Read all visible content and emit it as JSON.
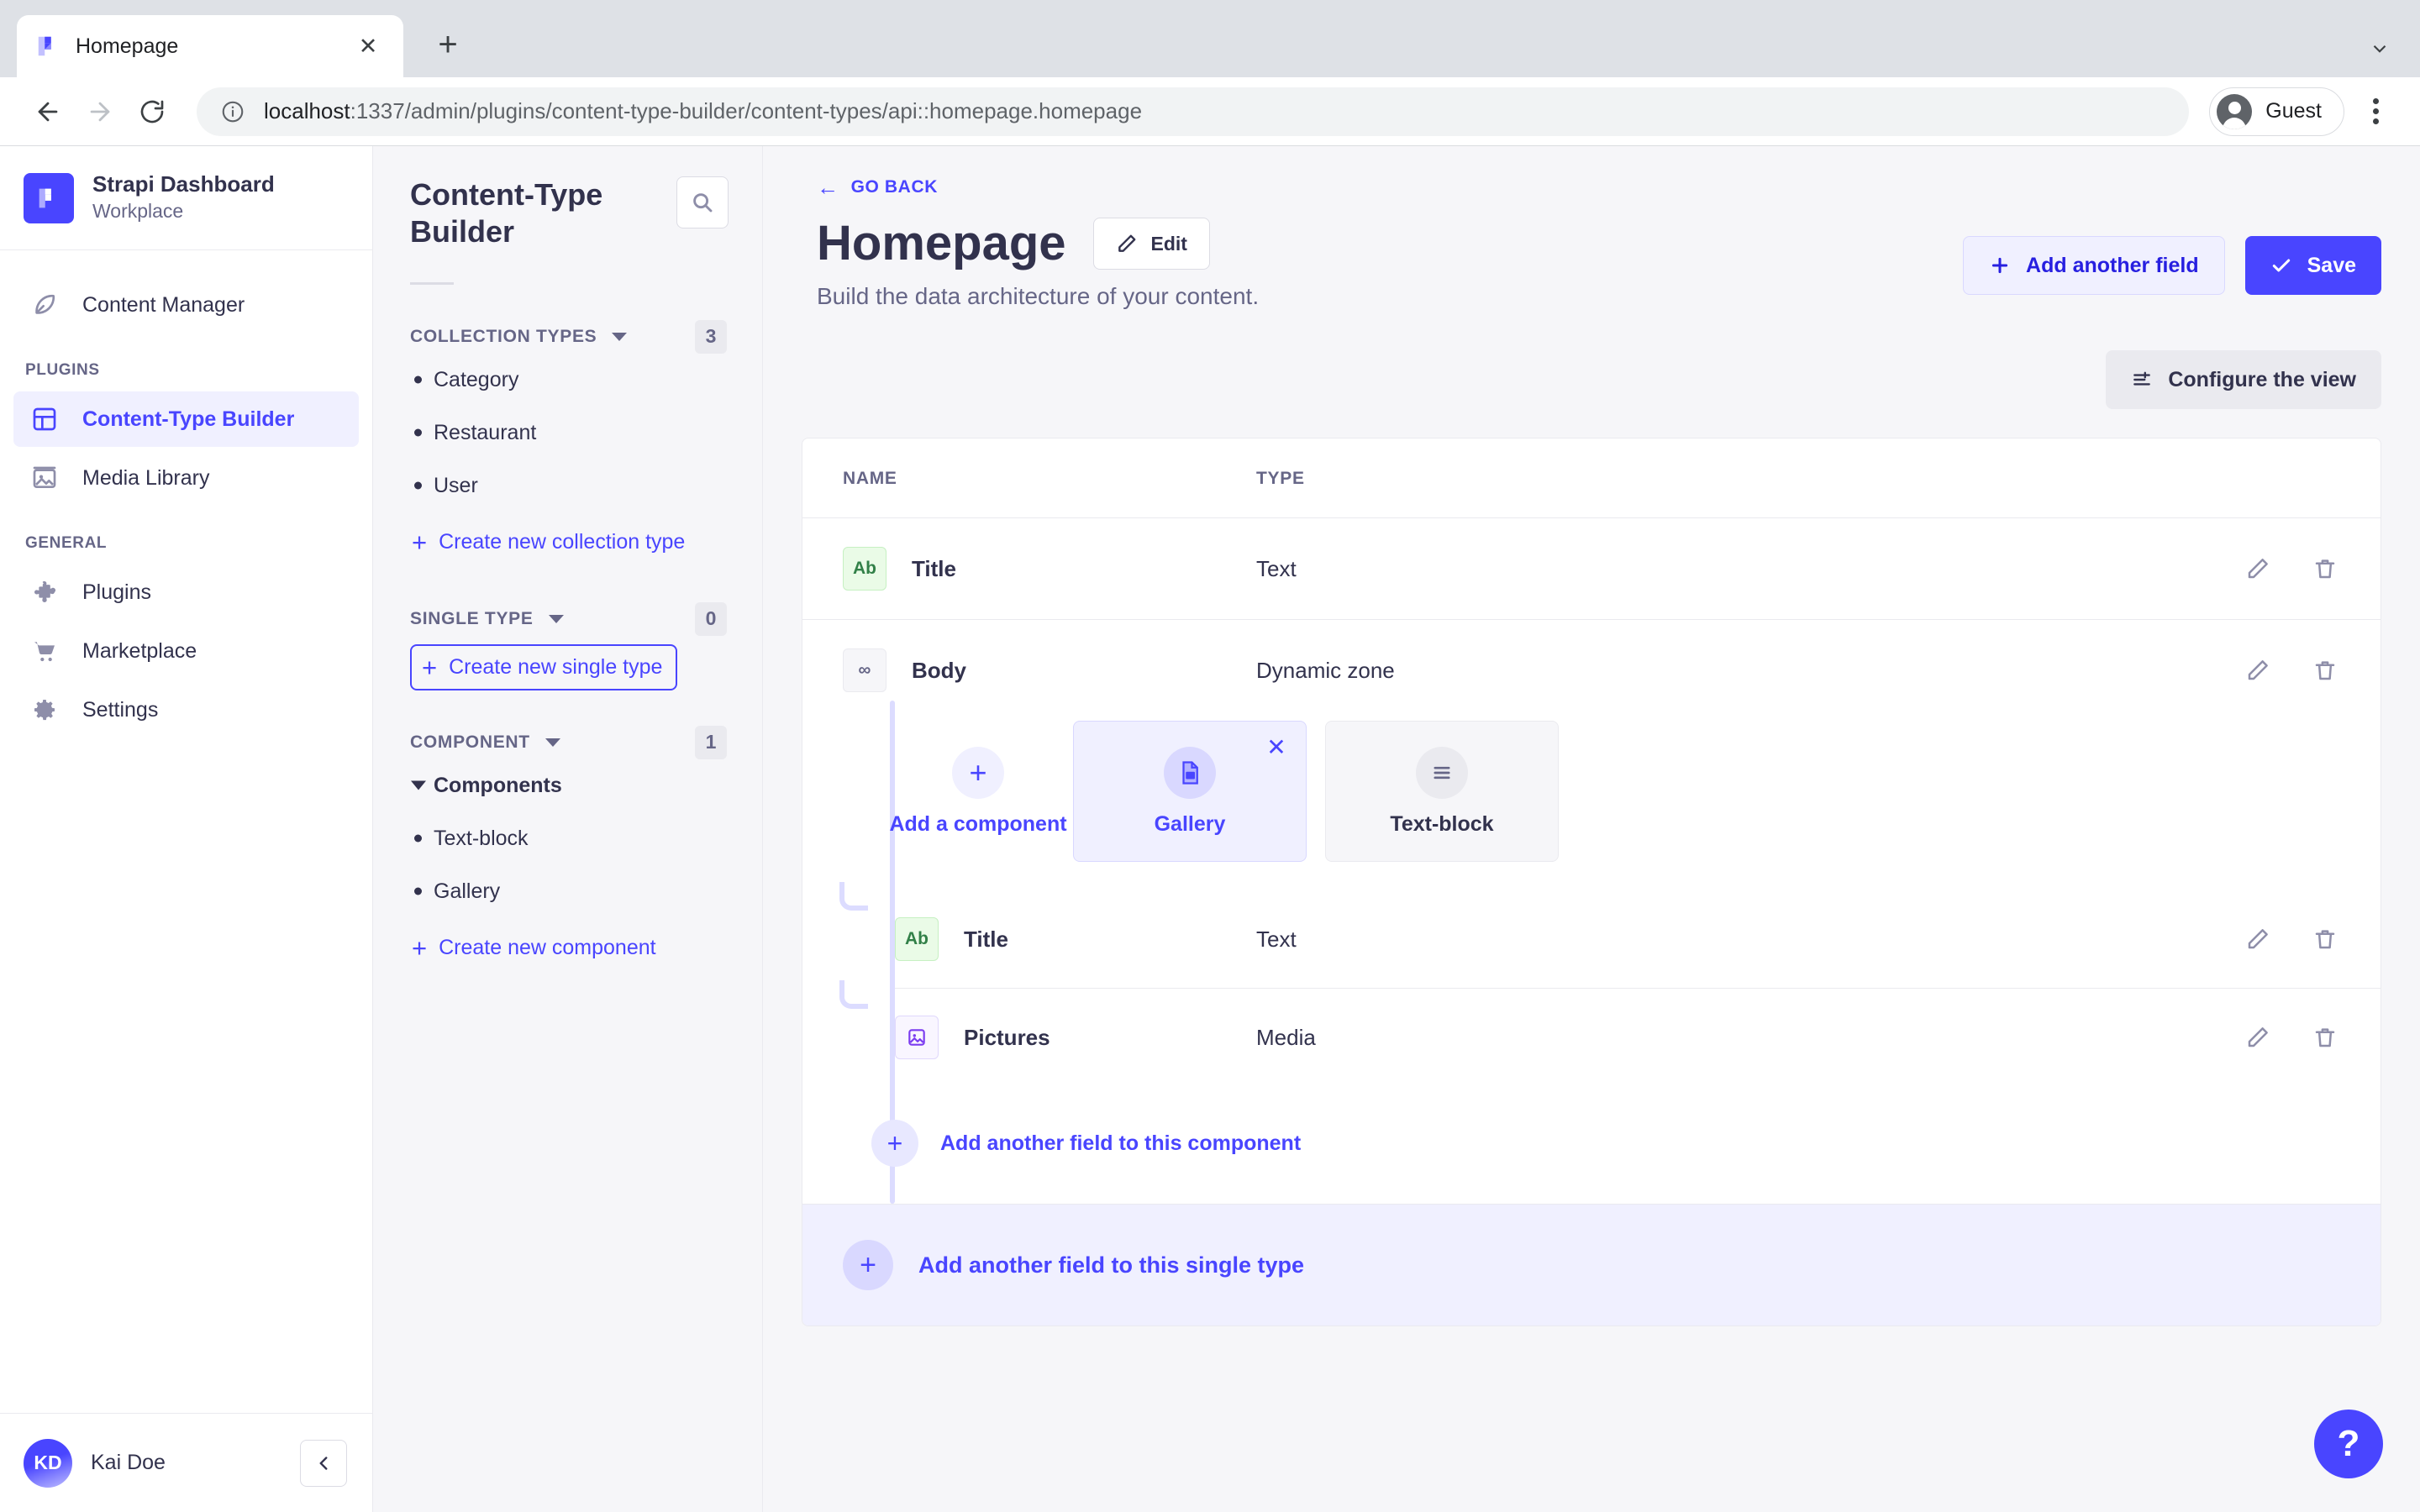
{
  "browser": {
    "tab_title": "Homepage",
    "close_label": "✕",
    "newtab_label": "+",
    "url_bold": "localhost",
    "url_rest": ":1337/admin/plugins/content-type-builder/content-types/api::homepage.homepage",
    "profile_label": "Guest"
  },
  "nav": {
    "brand_title": "Strapi Dashboard",
    "brand_subtitle": "Workplace",
    "items": [
      {
        "label": "Content Manager",
        "icon": "feather-pen-icon",
        "active": false
      }
    ],
    "sections": [
      {
        "label": "PLUGINS",
        "items": [
          {
            "label": "Content-Type Builder",
            "icon": "layout-icon",
            "active": true
          },
          {
            "label": "Media Library",
            "icon": "image-icon",
            "active": false
          }
        ]
      },
      {
        "label": "GENERAL",
        "items": [
          {
            "label": "Plugins",
            "icon": "puzzle-icon",
            "active": false
          },
          {
            "label": "Marketplace",
            "icon": "shopping-cart-icon",
            "active": false
          },
          {
            "label": "Settings",
            "icon": "gear-icon",
            "active": false
          }
        ]
      }
    ],
    "user_initials": "KD",
    "user_name": "Kai Doe",
    "collapse_icon": "chevron-left-icon"
  },
  "ctb": {
    "title": "Content-Type Builder",
    "search_icon": "search-icon",
    "groups": [
      {
        "label": "COLLECTION TYPES",
        "count": "3",
        "items": [
          {
            "label": "Category",
            "type": "leaf"
          },
          {
            "label": "Restaurant",
            "type": "leaf"
          },
          {
            "label": "User",
            "type": "leaf"
          }
        ],
        "link": "Create new collection type",
        "link_focused": false
      },
      {
        "label": "SINGLE TYPE",
        "count": "0",
        "items": [],
        "link": "Create new single type",
        "link_focused": true
      },
      {
        "label": "COMPONENT",
        "count": "1",
        "items": [
          {
            "label": "Components",
            "type": "group"
          },
          {
            "label": "Text-block",
            "type": "leaf"
          },
          {
            "label": "Gallery",
            "type": "leaf"
          }
        ],
        "link": "Create new component",
        "link_focused": false
      }
    ]
  },
  "main": {
    "go_back": "GO BACK",
    "page_title": "Homepage",
    "edit_label": "Edit",
    "page_subtitle": "Build the data architecture of your content.",
    "add_field_label": "Add another field",
    "save_label": "Save",
    "configure_label": "Configure the view",
    "table": {
      "headers": {
        "name": "NAME",
        "type": "TYPE"
      },
      "rows": [
        {
          "badge": "Ab",
          "badge_kind": "text",
          "name": "Title",
          "type": "Text"
        },
        {
          "badge": "∞",
          "badge_kind": "dz",
          "name": "Body",
          "type": "Dynamic zone"
        }
      ]
    },
    "dynamic_zone": {
      "add_component_label": "Add a component",
      "components": [
        {
          "label": "Gallery",
          "selected": true,
          "icon": "file-image-icon",
          "close_label": "✕"
        },
        {
          "label": "Text-block",
          "selected": false,
          "icon": "lines-icon"
        }
      ],
      "fields": [
        {
          "badge": "Ab",
          "badge_kind": "text",
          "name": "Title",
          "type": "Text"
        },
        {
          "badge": "▣",
          "badge_kind": "media",
          "name": "Pictures",
          "type": "Media"
        }
      ],
      "add_field_component_label": "Add another field to this component"
    },
    "add_field_single_type_label": "Add another field to this single type",
    "help_label": "?"
  },
  "colors": {
    "accent": "#4945ff",
    "accent_soft": "#f0f0ff",
    "text": "#32324d",
    "muted": "#666687",
    "border": "#eaeaef",
    "page_bg": "#f6f6f9",
    "badge_text_bg": "#eafbe7",
    "badge_media_bg": "#f9f6ff"
  }
}
